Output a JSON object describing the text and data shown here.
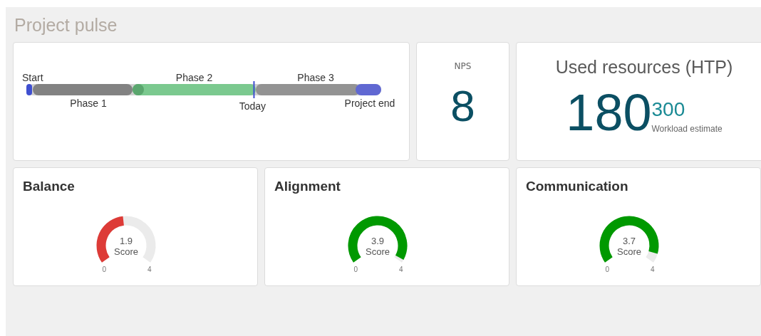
{
  "title": "Project pulse",
  "timeline": {
    "start": "Start",
    "end": "Project end",
    "today": {
      "label": "Today",
      "level": 0.64
    },
    "phases": [
      {
        "label": "Phase 1",
        "active": false
      },
      {
        "label": "Phase 2",
        "active": true
      },
      {
        "label": "Phase 3",
        "active": false
      }
    ]
  },
  "nps": {
    "label": "NPS",
    "value": "8"
  },
  "resources": {
    "title": "Used resources (HTP)",
    "value": "180",
    "estimate": "300",
    "estimate_label": "Workload estimate"
  },
  "gauges": [
    {
      "title": "Balance",
      "value": "1.9",
      "caption": "Score",
      "min": "0",
      "max": "4",
      "color": "#dd3b37"
    },
    {
      "title": "Alignment",
      "value": "3.9",
      "caption": "Score",
      "min": "0",
      "max": "4",
      "color": "#009900"
    },
    {
      "title": "Communication",
      "value": "3.7",
      "caption": "Score",
      "min": "0",
      "max": "4",
      "color": "#009900"
    }
  ]
}
